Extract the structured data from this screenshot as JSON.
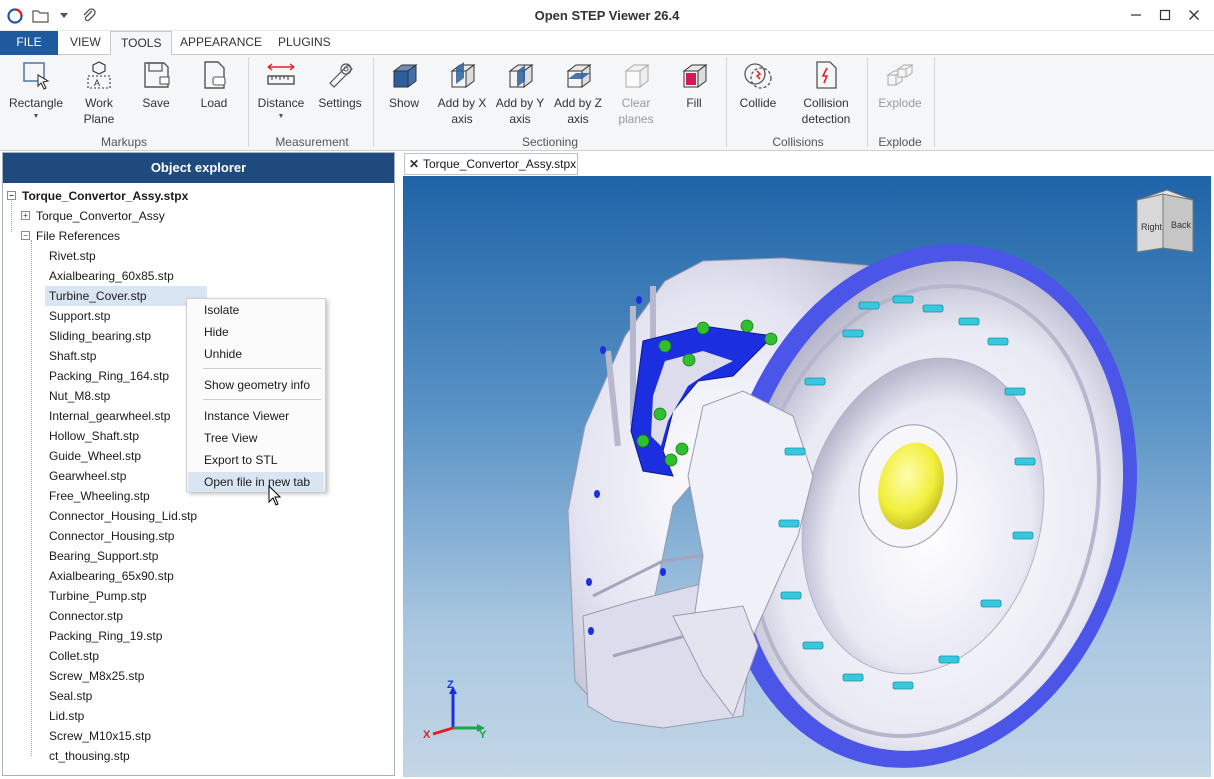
{
  "window": {
    "title": "Open STEP Viewer 26.4",
    "controls": [
      "minimize",
      "maximize",
      "close"
    ]
  },
  "quick_access": {
    "icons": [
      "app-logo-icon",
      "open-folder-icon",
      "dropdown-arrow-icon",
      "attachment-icon"
    ]
  },
  "ribbon_tabs": [
    {
      "label": "FILE"
    },
    {
      "label": "VIEW"
    },
    {
      "label": "TOOLS"
    },
    {
      "label": "APPEARANCE"
    },
    {
      "label": "PLUGINS"
    }
  ],
  "ribbon": {
    "markups": {
      "label": "Markups",
      "rectangle": "Rectangle",
      "work_plane_1": "Work",
      "work_plane_2": "Plane",
      "save": "Save",
      "load": "Load"
    },
    "measurement": {
      "label": "Measurement",
      "distance": "Distance",
      "settings": "Settings"
    },
    "sectioning": {
      "label": "Sectioning",
      "show": "Show",
      "add_x_1": "Add by X",
      "add_x_2": "axis",
      "add_y_1": "Add by Y",
      "add_y_2": "axis",
      "add_z_1": "Add by Z",
      "add_z_2": "axis",
      "clear_1": "Clear",
      "clear_2": "planes",
      "fill": "Fill"
    },
    "collisions": {
      "label": "Collisions",
      "collide": "Collide",
      "detection_1": "Collision",
      "detection_2": "detection"
    },
    "explode": {
      "label": "Explode",
      "explode": "Explode"
    }
  },
  "explorer": {
    "title": "Object explorer",
    "root": "Torque_Convertor_Assy.stpx",
    "assembly": "Torque_Convertor_Assy",
    "file_references": "File References",
    "files": [
      "Rivet.stp",
      "Axialbearing_60x85.stp",
      "Turbine_Cover.stp",
      "Support.stp",
      "Sliding_bearing.stp",
      "Shaft.stp",
      "Packing_Ring_164.stp",
      "Nut_M8.stp",
      "Internal_gearwheel.stp",
      "Hollow_Shaft.stp",
      "Guide_Wheel.stp",
      "Gearwheel.stp",
      "Free_Wheeling.stp",
      "Connector_Housing_Lid.stp",
      "Connector_Housing.stp",
      "Bearing_Support.stp",
      "Axialbearing_65x90.stp",
      "Turbine_Pump.stp",
      "Connector.stp",
      "Packing_Ring_19.stp",
      "Collet.stp",
      "Screw_M8x25.stp",
      "Seal.stp",
      "Lid.stp",
      "Screw_M10x15.stp",
      "ct_thousing.stp"
    ],
    "selected_file": "Turbine_Cover.stp"
  },
  "context_menu": {
    "items": [
      "Isolate",
      "Hide",
      "Unhide",
      "Show geometry info",
      "Instance Viewer",
      "Tree View",
      "Export to STL",
      "Open file in new tab"
    ],
    "highlighted": "Open file in new tab"
  },
  "document_tab": {
    "label": "Torque_Convertor_Assy.stpx"
  },
  "viewport": {
    "view_cube": {
      "face_right": "Right",
      "face_back": "Back"
    },
    "axes": {
      "x": "X",
      "y": "Y",
      "z": "Z"
    },
    "colors": {
      "bg_top": "#1f64a8",
      "bg_bottom": "#c3d6e6",
      "housing": "#ececf6",
      "rim": "#4b56e8",
      "bolts": "#35c9df",
      "flange": "#1b2fe0",
      "nuts": "#2fbf2f",
      "hub": "#f2ef3c"
    }
  },
  "theme": {
    "accent": "#1e5a9c",
    "explorer_header": "#1e4a7e",
    "selection": "#d9e5f3"
  }
}
